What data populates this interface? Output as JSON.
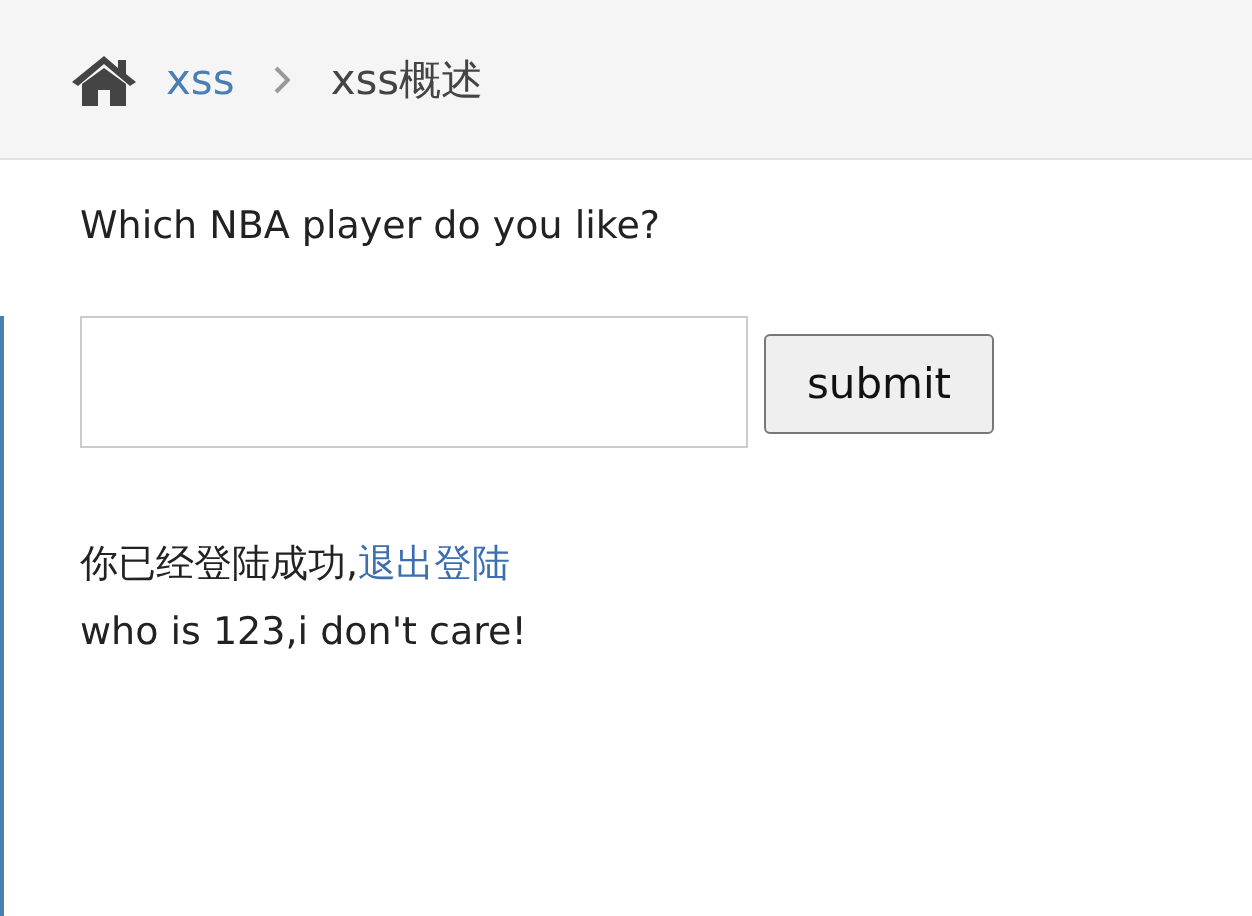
{
  "breadcrumb": [
    {
      "label": "xss",
      "kind": "link"
    },
    {
      "label": "xss概述",
      "kind": "current"
    }
  ],
  "question": "Which NBA player do you like?",
  "form": {
    "button": "submit"
  },
  "status": {
    "text": "你已经登陆成功,",
    "link": "退出登陆"
  },
  "result": "who is 123,i don't care!"
}
